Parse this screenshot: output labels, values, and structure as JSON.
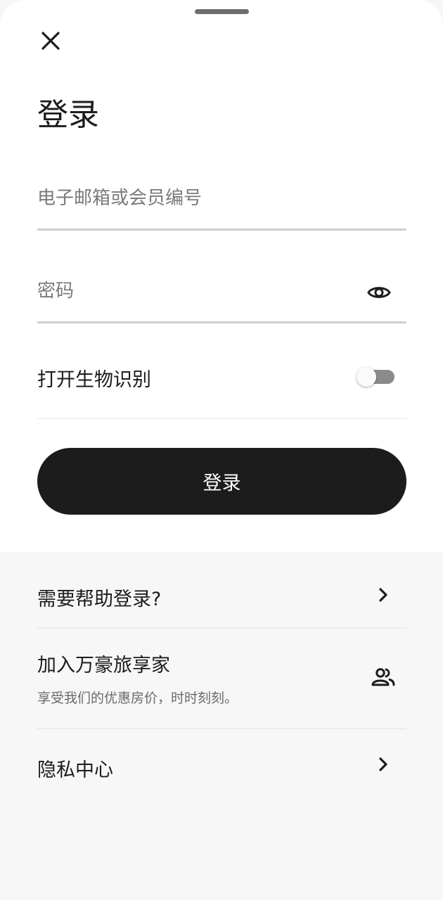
{
  "header": {
    "title": "登录",
    "close_icon": "close-icon"
  },
  "form": {
    "email_placeholder": "电子邮箱或会员编号",
    "email_value": "",
    "password_placeholder": "密码",
    "password_value": "",
    "password_toggle_icon": "eye-icon",
    "biometric_label": "打开生物识别",
    "biometric_enabled": false,
    "login_button": "登录"
  },
  "menu": {
    "help_label": "需要帮助登录?",
    "join_label": "加入万豪旅享家",
    "join_subtitle": "享受我们的优惠房价，时时刻刻。",
    "join_icon": "people-icon",
    "privacy_label": "隐私中心",
    "chevron_icon": "chevron-right-icon"
  },
  "colors": {
    "primary": "#1c1c1c",
    "background": "#f7f7f7",
    "surface": "#ffffff",
    "divider": "#e3e3e3",
    "muted_text": "#6a6a6a"
  }
}
